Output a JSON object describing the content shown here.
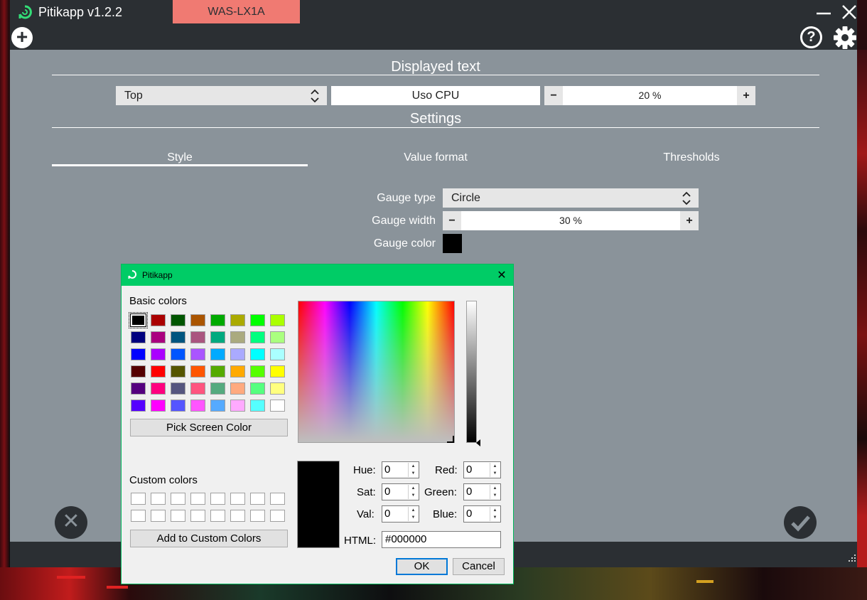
{
  "app": {
    "title": "Pitikapp v1.2.2",
    "device_tab": "WAS-LX1A",
    "icons": {
      "add": "plus-icon",
      "help": "help-icon",
      "settings": "gear-icon",
      "minimize": "minimize-icon",
      "close": "close-icon",
      "cancel": "x-icon",
      "confirm": "check-icon"
    },
    "add_glyph": "+",
    "help_glyph": "?",
    "cancel_glyph": "✕"
  },
  "displayed_text": {
    "heading": "Displayed text",
    "position_select": "Top",
    "label_value": "Uso CPU",
    "size_value": "20 %",
    "minus": "−",
    "plus": "+"
  },
  "settings": {
    "heading": "Settings",
    "tabs": [
      "Style",
      "Value format",
      "Thresholds"
    ],
    "active_tab": "Style",
    "gauge_type_label": "Gauge type",
    "gauge_type_value": "Circle",
    "gauge_width_label": "Gauge width",
    "gauge_width_value": "30 %",
    "gauge_color_label": "Gauge color",
    "gauge_color": "#000000"
  },
  "color_dialog": {
    "title": "Pitikapp",
    "close_glyph": "✕",
    "basic_colors_label": "Basic colors",
    "basic_colors": [
      [
        "#000000",
        "#aa0000",
        "#005500",
        "#aa5500",
        "#00aa00",
        "#aaaa00",
        "#00ff00",
        "#aaff00"
      ],
      [
        "#00007f",
        "#aa007f",
        "#00557f",
        "#aa557f",
        "#00aa7f",
        "#aaaa7f",
        "#00ff7f",
        "#aaff7f"
      ],
      [
        "#0000ff",
        "#aa00ff",
        "#0055ff",
        "#aa55ff",
        "#00aaff",
        "#aaaaff",
        "#00ffff",
        "#aaffff"
      ],
      [
        "#550000",
        "#ff0000",
        "#555500",
        "#ff5500",
        "#55aa00",
        "#ffaa00",
        "#55ff00",
        "#ffff00"
      ],
      [
        "#55007f",
        "#ff007f",
        "#55557f",
        "#ff557f",
        "#55aa7f",
        "#ffaa7f",
        "#55ff7f",
        "#ffff7f"
      ],
      [
        "#5500ff",
        "#ff00ff",
        "#5555ff",
        "#ff55ff",
        "#55aaff",
        "#ffaaff",
        "#55ffff",
        "#ffffff"
      ]
    ],
    "pick_screen_color": "Pick Screen Color",
    "custom_colors_label": "Custom colors",
    "add_to_custom": "Add to Custom Colors",
    "fields": {
      "hue_label": "Hue:",
      "hue": "0",
      "sat_label": "Sat:",
      "sat": "0",
      "val_label": "Val:",
      "val": "0",
      "red_label": "Red:",
      "red": "0",
      "green_label": "Green:",
      "green": "0",
      "blue_label": "Blue:",
      "blue": "0",
      "html_label": "HTML:",
      "html": "#000000"
    },
    "ok": "OK",
    "cancel": "Cancel"
  }
}
